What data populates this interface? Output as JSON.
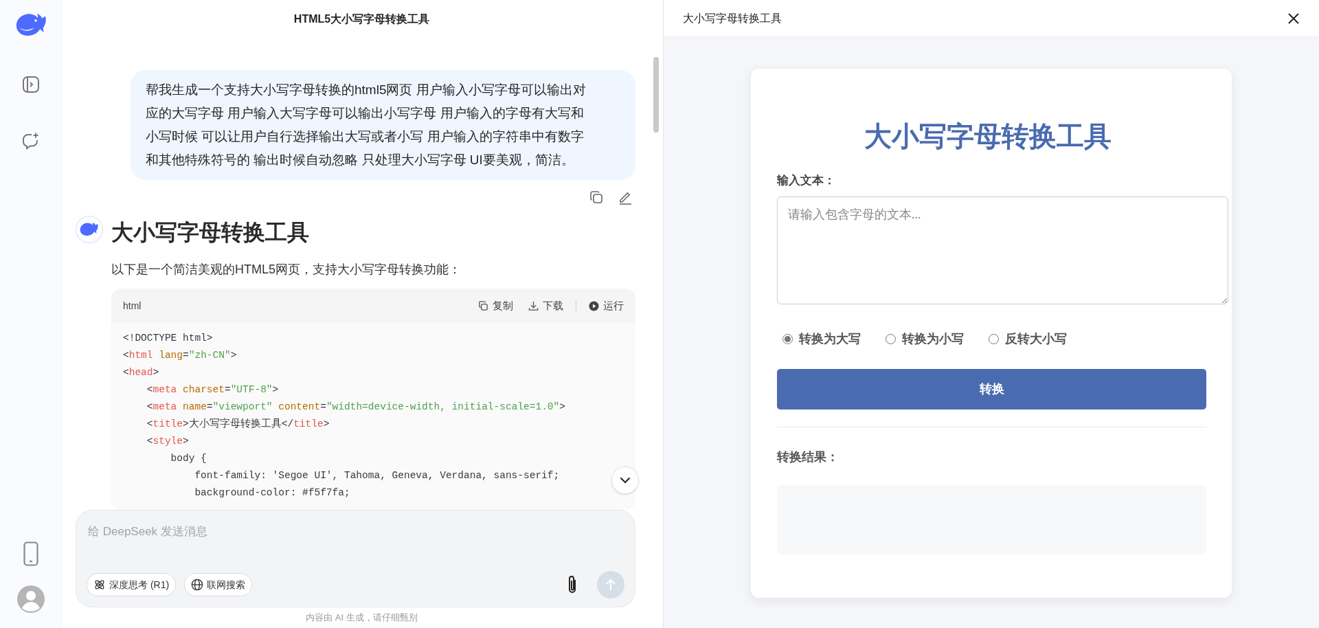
{
  "chat": {
    "title": "HTML5大小写字母转换工具",
    "user_message": {
      "lines": [
        "帮我生成一个支持大小写字母转换的html5网页 用户输入小写字母可以输出对",
        "应的大写字母 用户输入大写字母可以输出小写字母 用户输入的字母有大写和",
        "小写时候 可以让用户自行选择输出大写或者小写 用户输入的字符串中有数字",
        "和其他特殊符号的 输出时候自动忽略 只处理大小写字母 UI要美观，简洁。"
      ]
    },
    "assistant": {
      "heading": "大小写字母转换工具",
      "intro": "以下是一个简洁美观的HTML5网页，支持大小写字母转换功能：",
      "code_block": {
        "language": "html",
        "actions": [
          {
            "kind": "copy",
            "label": "复制"
          },
          {
            "kind": "download",
            "label": "下载"
          },
          {
            "kind": "run",
            "label": "运行"
          }
        ],
        "lines": [
          {
            "tokens": [
              {
                "kind": "plain",
                "text": "<!DOCTYPE html>"
              }
            ]
          },
          {
            "tokens": [
              {
                "kind": "plain",
                "text": "<"
              },
              {
                "kind": "tag",
                "text": "html"
              },
              {
                "kind": "attr",
                "text": " lang"
              },
              {
                "kind": "plain",
                "text": "="
              },
              {
                "kind": "str",
                "text": "\"zh-CN\""
              },
              {
                "kind": "plain",
                "text": ">"
              }
            ]
          },
          {
            "tokens": [
              {
                "kind": "plain",
                "text": "<"
              },
              {
                "kind": "tag",
                "text": "head"
              },
              {
                "kind": "plain",
                "text": ">"
              }
            ]
          },
          {
            "tokens": [
              {
                "kind": "plain",
                "text": "    <"
              },
              {
                "kind": "tag",
                "text": "meta"
              },
              {
                "kind": "attr",
                "text": " charset"
              },
              {
                "kind": "plain",
                "text": "="
              },
              {
                "kind": "str",
                "text": "\"UTF-8\""
              },
              {
                "kind": "plain",
                "text": ">"
              }
            ]
          },
          {
            "tokens": [
              {
                "kind": "plain",
                "text": "    <"
              },
              {
                "kind": "tag",
                "text": "meta"
              },
              {
                "kind": "attr",
                "text": " name"
              },
              {
                "kind": "plain",
                "text": "="
              },
              {
                "kind": "str",
                "text": "\"viewport\""
              },
              {
                "kind": "attr",
                "text": " content"
              },
              {
                "kind": "plain",
                "text": "="
              },
              {
                "kind": "str",
                "text": "\"width=device-width, initial-scale=1.0\""
              },
              {
                "kind": "plain",
                "text": ">"
              }
            ]
          },
          {
            "tokens": [
              {
                "kind": "plain",
                "text": "    <"
              },
              {
                "kind": "tag",
                "text": "title"
              },
              {
                "kind": "plain",
                "text": ">大小写字母转换工具</"
              },
              {
                "kind": "tag",
                "text": "title"
              },
              {
                "kind": "plain",
                "text": ">"
              }
            ]
          },
          {
            "tokens": [
              {
                "kind": "plain",
                "text": "    <"
              },
              {
                "kind": "tag",
                "text": "style"
              },
              {
                "kind": "plain",
                "text": ">"
              }
            ]
          },
          {
            "tokens": [
              {
                "kind": "plain",
                "text": "        body {"
              }
            ]
          },
          {
            "tokens": [
              {
                "kind": "plain",
                "text": "            font-family: 'Segoe UI', Tahoma, Geneva, Verdana, sans-serif;"
              }
            ]
          },
          {
            "tokens": [
              {
                "kind": "plain",
                "text": "            background-color: #f5f7fa;"
              }
            ]
          }
        ]
      }
    }
  },
  "composer": {
    "placeholder": "给 DeepSeek 发送消息",
    "toggles": [
      {
        "kind": "think",
        "label": "深度思考 (R1)",
        "on": false
      },
      {
        "kind": "web",
        "label": "联网搜索",
        "on": false
      }
    ],
    "send_disabled": true
  },
  "disclaimer": "内容由 AI 生成，请仔细甄别",
  "preview": {
    "title": "大小写字母转换工具",
    "app": {
      "heading": "大小写字母转换工具",
      "input_label": "输入文本：",
      "input_placeholder": "请输入包含字母的文本...",
      "options": [
        {
          "label": "转换为大写",
          "selected": true
        },
        {
          "label": "转换为小写",
          "selected": false
        },
        {
          "label": "反转大小写",
          "selected": false
        }
      ],
      "button": "转换",
      "result_label": "转换结果："
    }
  }
}
